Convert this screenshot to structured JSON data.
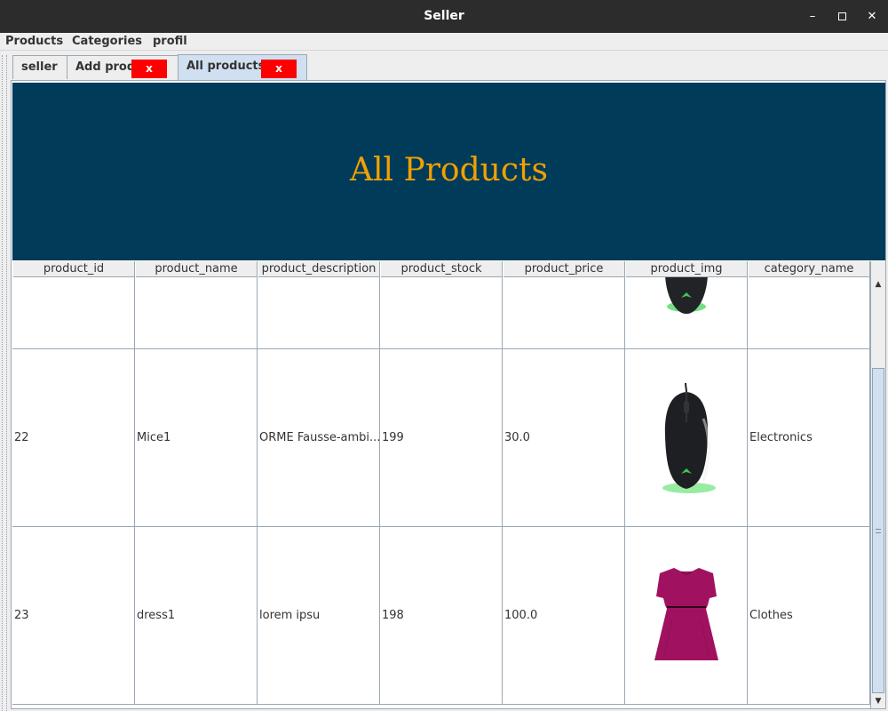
{
  "window": {
    "title": "Seller"
  },
  "menubar": {
    "items": [
      "Products",
      "Categories",
      "profil"
    ]
  },
  "tabs": [
    {
      "label": "seller",
      "close": null,
      "selected": false
    },
    {
      "label": "Add prod",
      "close": "x",
      "selected": false
    },
    {
      "label": "All products",
      "close": "x",
      "selected": true
    }
  ],
  "banner": {
    "title": "All Products",
    "background": "#003b5a",
    "color": "#f2a000"
  },
  "table": {
    "columns": [
      "product_id",
      "product_name",
      "product_description",
      "product_stock",
      "product_price",
      "product_img",
      "category_name"
    ],
    "rows": [
      {
        "product_id": "",
        "product_name": "",
        "product_description": "",
        "product_stock": "",
        "product_price": "",
        "product_img": "mouse-image",
        "category_name": ""
      },
      {
        "product_id": "22",
        "product_name": "Mice1",
        "product_description": "ORME Fausse-ambi...",
        "product_stock": "199",
        "product_price": "30.0",
        "product_img": "mouse-image",
        "category_name": "Electronics"
      },
      {
        "product_id": "23",
        "product_name": "dress1",
        "product_description": "lorem ipsu",
        "product_stock": "198",
        "product_price": "100.0",
        "product_img": "dress-image",
        "category_name": "Clothes"
      }
    ]
  },
  "colors": {
    "close_button": "#ff0000",
    "selected_tab": "#d1e0f0",
    "grid": "#9aa8b5"
  }
}
